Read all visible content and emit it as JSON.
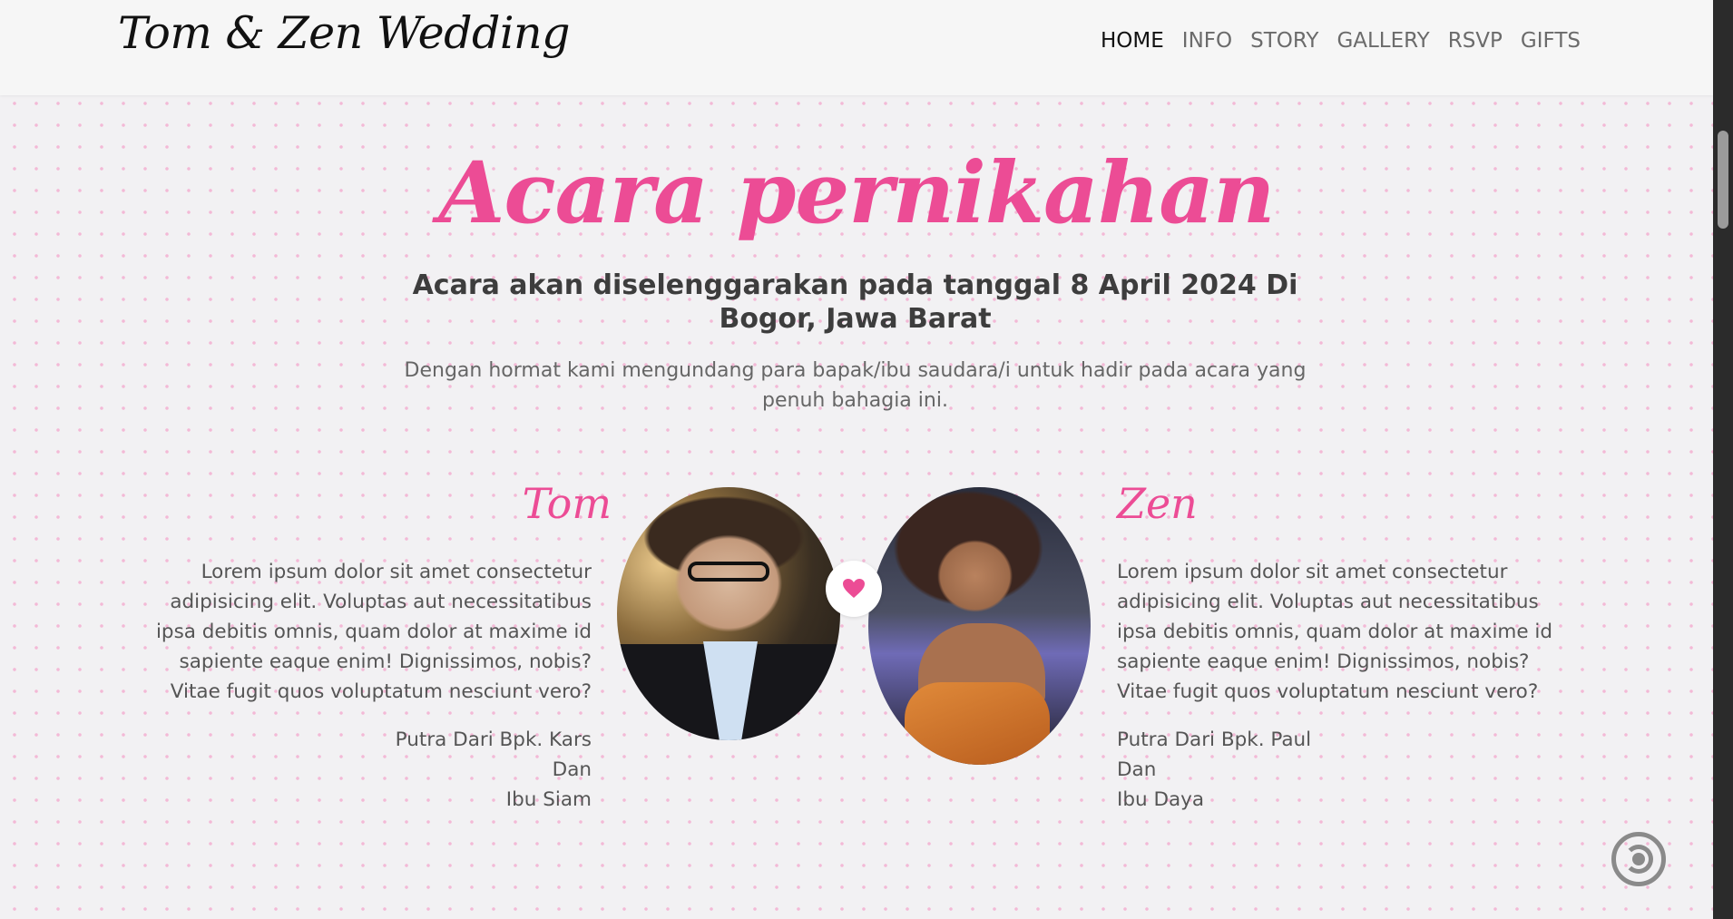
{
  "brand": "Tom & Zen Wedding",
  "nav": [
    {
      "label": "HOME",
      "active": true
    },
    {
      "label": "INFO"
    },
    {
      "label": "STORY"
    },
    {
      "label": "GALLERY"
    },
    {
      "label": "RSVP"
    },
    {
      "label": "GIFTS"
    }
  ],
  "event": {
    "title": "Acara pernikahan",
    "subtitle": "Acara akan diselenggarakan pada tanggal 8 April 2024 Di Bogor, Jawa Barat",
    "description": "Dengan hormat kami mengundang para bapak/ibu saudara/i untuk hadir pada acara yang penuh bahagia ini."
  },
  "groom": {
    "name": "Tom",
    "bio": "Lorem ipsum dolor sit amet consectetur adipisicing elit. Voluptas aut necessitatibus ipsa debitis omnis, quam dolor at maxime id sapiente eaque enim! Dignissimos, nobis? Vitae fugit quos voluptatum nesciunt vero?",
    "parents": [
      "Putra Dari Bpk. Kars",
      "Dan",
      "Ibu Siam"
    ]
  },
  "bride": {
    "name": "Zen",
    "bio": "Lorem ipsum dolor sit amet consectetur adipisicing elit. Voluptas aut necessitatibus ipsa debitis omnis, quam dolor at maxime id sapiente eaque enim! Dignissimos, nobis? Vitae fugit quos voluptatum nesciunt vero?",
    "parents": [
      "Putra Dari Bpk. Paul",
      "Dan",
      "Ibu Daya"
    ]
  },
  "icons": {
    "heart": "heart-icon",
    "music": "music-toggle-icon"
  },
  "colors": {
    "accent": "#ec4c95",
    "background": "#f2f1f3",
    "navbar": "#f6f6f6",
    "dots": "#f3b9d6"
  }
}
